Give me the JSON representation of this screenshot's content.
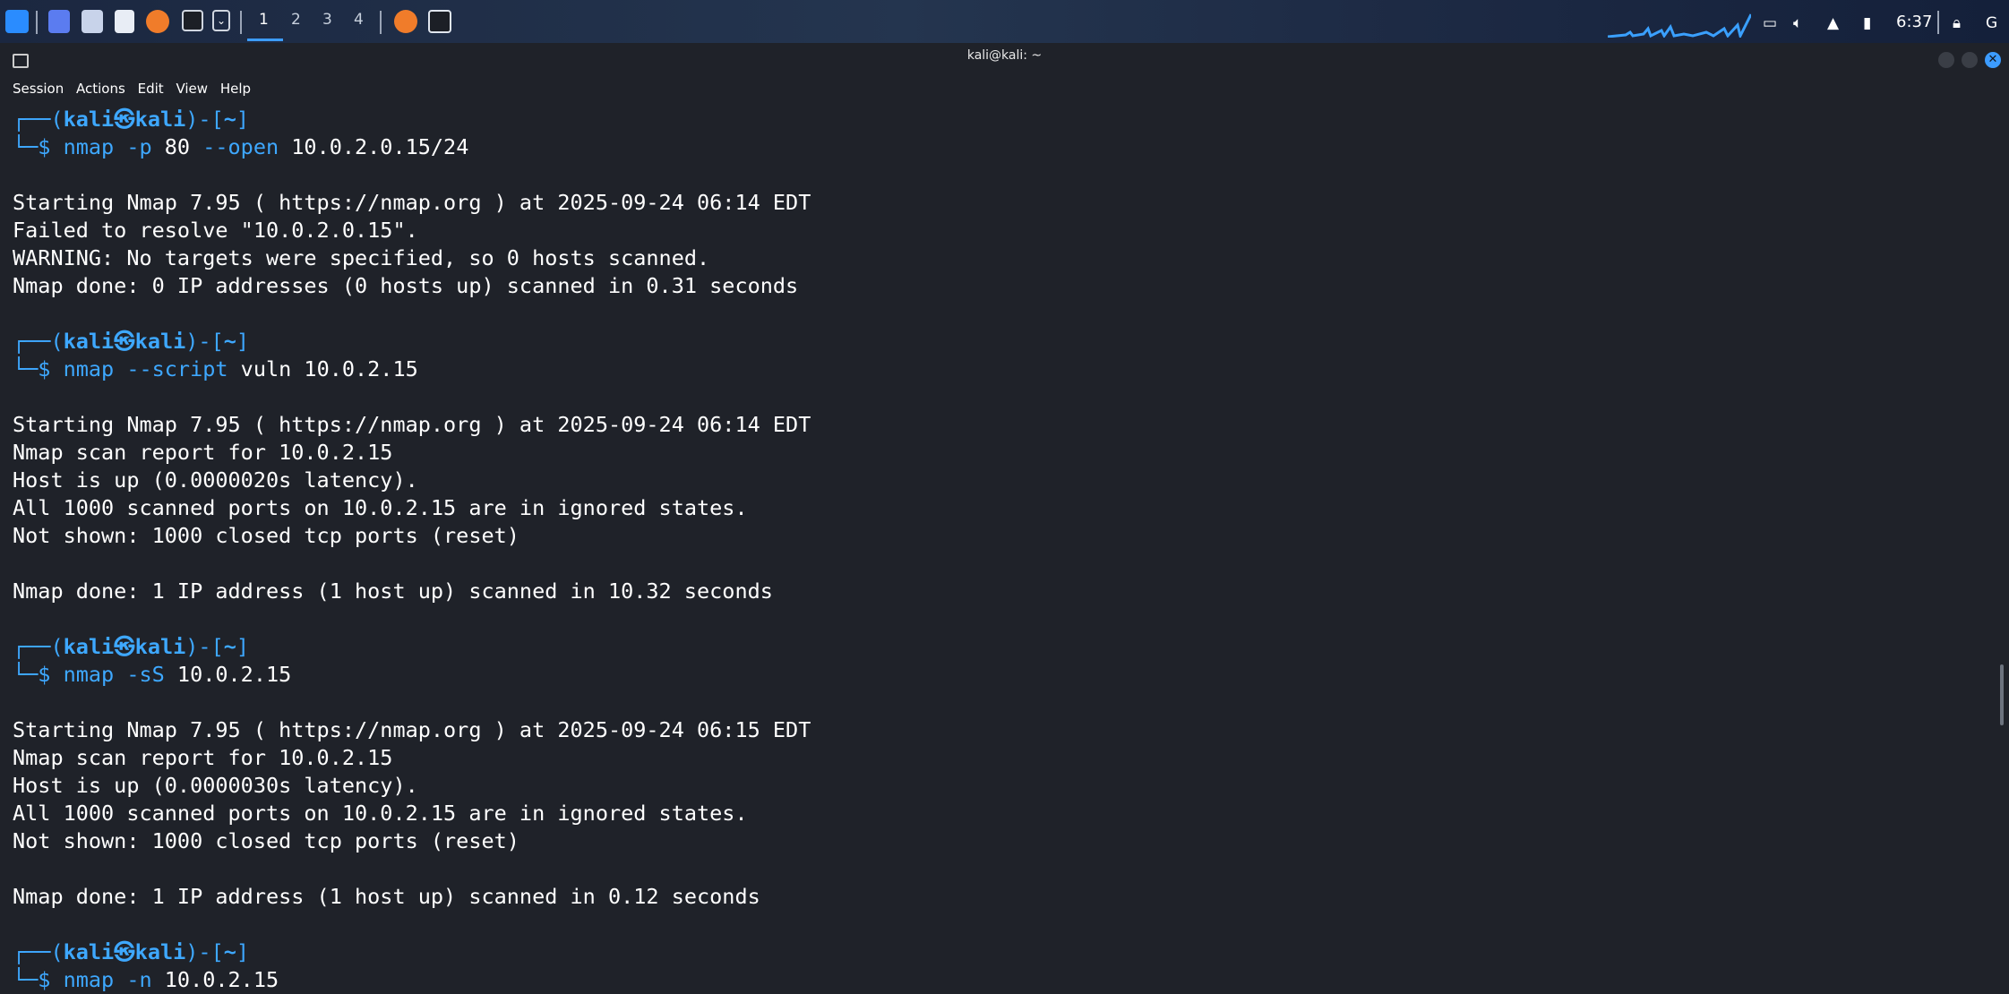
{
  "taskbar": {
    "workspaces": [
      "1",
      "2",
      "3",
      "4"
    ],
    "active_workspace": "1",
    "clock": "6:37",
    "icons": [
      "kali-menu-icon",
      "desktop-icon",
      "file-manager-icon",
      "text-editor-icon",
      "firefox-icon",
      "terminal-icon",
      "dropdown-icon",
      "firefox-running-icon",
      "terminal-running-icon",
      "display-icon",
      "volume-icon",
      "notification-icon",
      "battery-icon",
      "lock-icon",
      "power-icon"
    ]
  },
  "window": {
    "title": "kali@kali: ~",
    "menu": [
      "Session",
      "Actions",
      "Edit",
      "View",
      "Help"
    ]
  },
  "prompt": {
    "open": "┌──(",
    "user": "kali㉿kali",
    "close": ")-[",
    "dir": "~",
    "end": "]",
    "line2": "└─",
    "dollar": "$ "
  },
  "commands": [
    {
      "cmd": "nmap",
      "args": " -p",
      "rest": " 80 ",
      "args2": "--open",
      "rest2": " 10.0.2.0.15/24",
      "output": [
        "",
        "Starting Nmap 7.95 ( https://nmap.org ) at 2025-09-24 06:14 EDT",
        "Failed to resolve \"10.0.2.0.15\".",
        "WARNING: No targets were specified, so 0 hosts scanned.",
        "Nmap done: 0 IP addresses (0 hosts up) scanned in 0.31 seconds",
        ""
      ]
    },
    {
      "cmd": "nmap",
      "args": " --script",
      "rest": " vuln 10.0.2.15",
      "args2": "",
      "rest2": "",
      "output": [
        "",
        "Starting Nmap 7.95 ( https://nmap.org ) at 2025-09-24 06:14 EDT",
        "Nmap scan report for 10.0.2.15",
        "Host is up (0.0000020s latency).",
        "All 1000 scanned ports on 10.0.2.15 are in ignored states.",
        "Not shown: 1000 closed tcp ports (reset)",
        "",
        "Nmap done: 1 IP address (1 host up) scanned in 10.32 seconds",
        ""
      ]
    },
    {
      "cmd": "nmap",
      "args": " -sS",
      "rest": " 10.0.2.15",
      "args2": "",
      "rest2": "",
      "output": [
        "",
        "Starting Nmap 7.95 ( https://nmap.org ) at 2025-09-24 06:15 EDT",
        "Nmap scan report for 10.0.2.15",
        "Host is up (0.0000030s latency).",
        "All 1000 scanned ports on 10.0.2.15 are in ignored states.",
        "Not shown: 1000 closed tcp ports (reset)",
        "",
        "Nmap done: 1 IP address (1 host up) scanned in 0.12 seconds",
        ""
      ]
    },
    {
      "cmd": "nmap",
      "args": " -n",
      "rest": " 10.0.2.15",
      "args2": "",
      "rest2": "",
      "output": []
    }
  ]
}
